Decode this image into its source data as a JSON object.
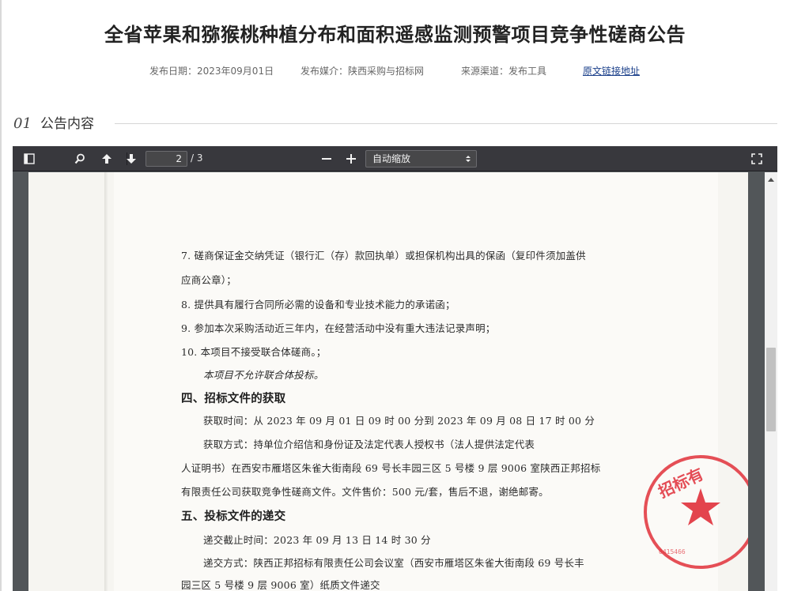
{
  "header": {
    "title": "全省苹果和猕猴桃种植分布和面积遥感监测预警项目竞争性磋商公告",
    "publish_date": "发布日期：2023年09月01日",
    "publish_media": "发布媒介：陕西采购与招标网",
    "source": "来源渠道：发布工具",
    "original_link": "原文链接地址"
  },
  "section": {
    "number": "01",
    "title": "公告内容"
  },
  "viewer": {
    "current_page": "2",
    "total_pages": "/ 3",
    "zoom": "自动缩放",
    "icons": [
      "sidebar-toggle-icon",
      "search-icon",
      "arrow-up-icon",
      "arrow-down-icon",
      "minus-icon",
      "plus-icon",
      "fullscreen-icon"
    ]
  },
  "document": {
    "lines": [
      "7. 磋商保证金交纳凭证（银行汇（存）款回执单）或担保机构出具的保函（复印件须加盖供",
      "应商公章）；",
      "8. 提供具有履行合同所必需的设备和专业技术能力的承诺函；",
      "9. 参加本次采购活动近三年内，在经营活动中没有重大违法记录声明；",
      "10. 本项目不接受联合体磋商。；",
      "本项目不允许联合体投标。",
      "四、招标文件的获取",
      "获取时间：从 2023 年 09 月 01 日  09 时 00 分到 2023 年 09 月 08 日  17 时 00 分",
      "获取方式：持单位介绍信和身份证及法定代表人授权书（法人提供法定代表",
      "人证明书）在西安市雁塔区朱雀大街南段 69 号长丰园三区 5 号楼 9 层 9006 室陕西正邦招标",
      "有限责任公司获取竞争性磋商文件。文件售价：500 元/套，售后不退，谢绝邮寄。",
      "五、投标文件的递交",
      "递交截止时间：2023 年 09 月 13 日  14 时 30 分",
      "递交方式：陕西正邦招标有限责任公司会议室（西安市雁塔区朱雀大街南段 69 号长丰",
      "园三区 5 号楼 9 层 9006 室）纸质文件递交"
    ],
    "seal_text": "招标有",
    "seal_number": "0415466"
  },
  "colors": {
    "toolbar": "#38383d",
    "viewer_bg": "#525659",
    "link": "#1a3f8a",
    "seal_red": "#e0303a"
  }
}
